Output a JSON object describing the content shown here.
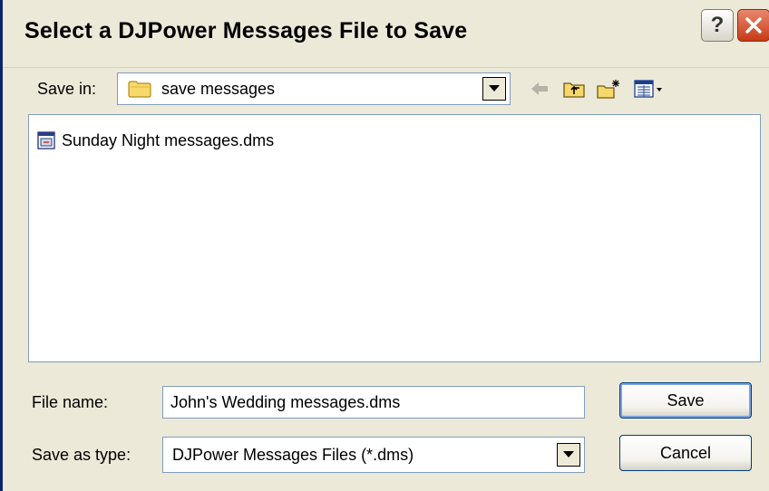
{
  "window": {
    "title": "Select a DJPower Messages File to Save",
    "help_label": "?"
  },
  "save_in": {
    "label": "Save in:",
    "value": "save messages"
  },
  "toolbar": {
    "icons": [
      "back-arrow-icon",
      "up-folder-icon",
      "new-folder-icon",
      "view-menu-icon"
    ]
  },
  "files": [
    {
      "name": "Sunday Night messages.dms",
      "icon": "dms-file-icon"
    }
  ],
  "file_name": {
    "label": "File name:",
    "value": "John's Wedding messages.dms"
  },
  "save_as_type": {
    "label": "Save as type:",
    "value": "DJPower Messages Files (*.dms)"
  },
  "buttons": {
    "save": "Save",
    "cancel": "Cancel"
  },
  "colors": {
    "dialog_bg": "#ece9d8",
    "field_border": "#7f9db9",
    "close_red": "#c63a16",
    "button_border": "#003c74"
  }
}
